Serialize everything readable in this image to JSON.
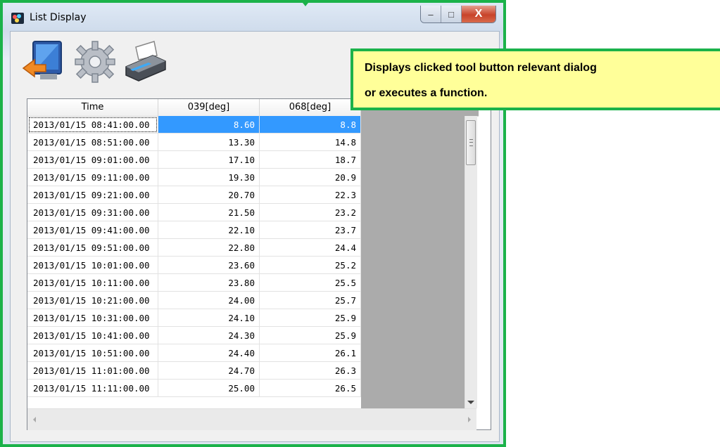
{
  "window": {
    "title": "List Display",
    "minimize": "–",
    "maximize": "□",
    "close": "X"
  },
  "toolbar": {
    "buttons": [
      {
        "name": "exit-button",
        "icon": "monitor-exit-icon"
      },
      {
        "name": "settings-button",
        "icon": "gear-icon"
      },
      {
        "name": "print-button",
        "icon": "printer-icon"
      }
    ]
  },
  "callout": {
    "line1": "Displays clicked tool button relevant dialog",
    "line2": "or executes a function."
  },
  "table": {
    "headers": [
      "Time",
      "039[deg]",
      "068[deg]"
    ],
    "rows": [
      [
        "2013/01/15 08:41:00.00",
        "8.60",
        "8.8"
      ],
      [
        "2013/01/15 08:51:00.00",
        "13.30",
        "14.8"
      ],
      [
        "2013/01/15 09:01:00.00",
        "17.10",
        "18.7"
      ],
      [
        "2013/01/15 09:11:00.00",
        "19.30",
        "20.9"
      ],
      [
        "2013/01/15 09:21:00.00",
        "20.70",
        "22.3"
      ],
      [
        "2013/01/15 09:31:00.00",
        "21.50",
        "23.2"
      ],
      [
        "2013/01/15 09:41:00.00",
        "22.10",
        "23.7"
      ],
      [
        "2013/01/15 09:51:00.00",
        "22.80",
        "24.4"
      ],
      [
        "2013/01/15 10:01:00.00",
        "23.60",
        "25.2"
      ],
      [
        "2013/01/15 10:11:00.00",
        "23.80",
        "25.5"
      ],
      [
        "2013/01/15 10:21:00.00",
        "24.00",
        "25.7"
      ],
      [
        "2013/01/15 10:31:00.00",
        "24.10",
        "25.9"
      ],
      [
        "2013/01/15 10:41:00.00",
        "24.30",
        "25.9"
      ],
      [
        "2013/01/15 10:51:00.00",
        "24.40",
        "26.1"
      ],
      [
        "2013/01/15 11:01:00.00",
        "24.70",
        "26.3"
      ],
      [
        "2013/01/15 11:11:00.00",
        "25.00",
        "26.5"
      ]
    ]
  },
  "colors": {
    "highlight_border": "#1bb24a",
    "callout_bg": "#ffff99",
    "selection": "#3399ff"
  }
}
